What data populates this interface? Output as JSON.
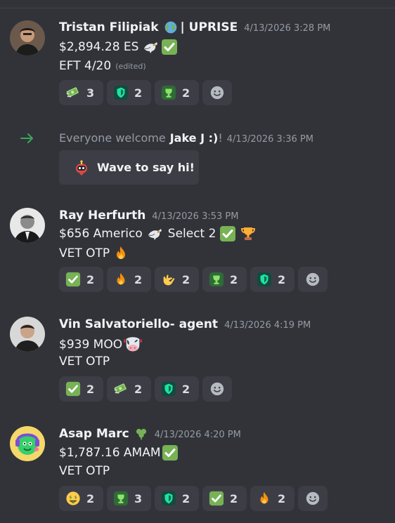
{
  "colors": {
    "background": "#323339",
    "reaction_bg": "#3d3e45",
    "join_arrow": "#3ba55c",
    "timestamp": "#949ba4"
  },
  "messages": [
    {
      "username": "Tristan Filipiak",
      "username_suffix": "| UPRISE",
      "timestamp": "4/13/2026 3:28 PM",
      "line1": "$2,894.28 ES",
      "line1_emojis": [
        "eagle",
        "check-mark"
      ],
      "line2": "EFT 4/20",
      "edited": "(edited)",
      "reactions": [
        {
          "icon": "money-with-wings",
          "count": "3"
        },
        {
          "icon": "green-shield",
          "count": "2"
        },
        {
          "icon": "trophy-badge",
          "count": "2"
        }
      ]
    },
    {
      "username": "Ray Herfurth",
      "timestamp": "4/13/2026 3:53 PM",
      "line1": "$656 Americo",
      "line1_mid": "Select 2",
      "line2": "VET OTP",
      "reactions": [
        {
          "icon": "check-mark",
          "count": "2"
        },
        {
          "icon": "fire",
          "count": "2"
        },
        {
          "icon": "call-me-hand",
          "count": "2"
        },
        {
          "icon": "trophy-badge",
          "count": "2"
        },
        {
          "icon": "green-shield",
          "count": "2"
        }
      ]
    },
    {
      "username": "Vin Salvatoriello- agent",
      "timestamp": "4/13/2026 4:19 PM",
      "line1": "$939 MOO",
      "line2": "VET OTP",
      "reactions": [
        {
          "icon": "check-mark",
          "count": "2"
        },
        {
          "icon": "money-with-wings",
          "count": "2"
        },
        {
          "icon": "green-shield",
          "count": "2"
        }
      ]
    },
    {
      "username": "Asap Marc",
      "timestamp": "4/13/2026 4:20 PM",
      "line1": "$1,787.16 AMAM",
      "line2": "VET OTP",
      "reactions": [
        {
          "icon": "money-mouth-face",
          "count": "2"
        },
        {
          "icon": "trophy-badge",
          "count": "3"
        },
        {
          "icon": "green-shield",
          "count": "2"
        },
        {
          "icon": "check-mark",
          "count": "2"
        },
        {
          "icon": "fire",
          "count": "2"
        }
      ]
    }
  ],
  "join": {
    "prefix": "Everyone welcome",
    "name": "Jake J :)",
    "suffix": "!",
    "timestamp": "4/13/2026 3:36 PM",
    "wave_label": "Wave to say hi!"
  }
}
